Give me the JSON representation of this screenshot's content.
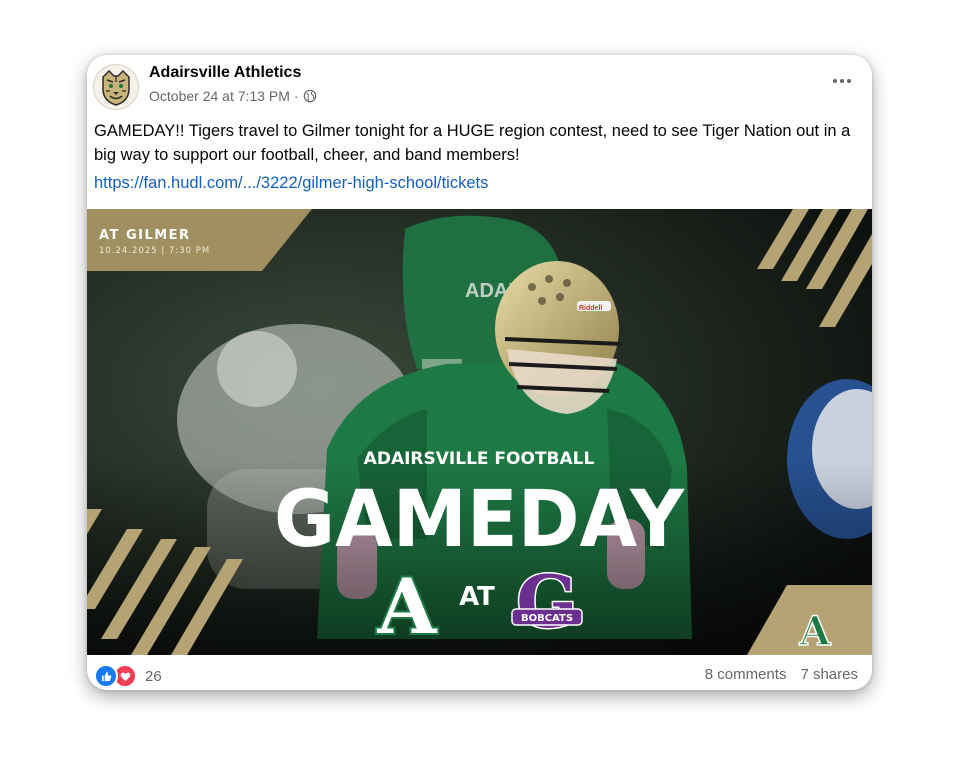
{
  "post": {
    "author": "Adairsville Athletics",
    "timestamp": "October 24 at 7:13 PM",
    "separator": "·",
    "privacy_icon": "globe-icon",
    "more_icon": "more-horizontal-icon",
    "text": "GAMEDAY!! Tigers travel to Gilmer tonight for a HUGE region contest, need to see Tiger Nation out in a big way to support our football, cheer, and band members!",
    "link": "https://fan.hudl.com/.../3222/gilmer-high-school/tickets"
  },
  "graphic": {
    "location": "AT GILMER",
    "date_time": "10.24.2025 | 7:30 PM",
    "program": "ADAIRSVILLE FOOTBALL",
    "headline": "GAMEDAY",
    "home_logo_letter": "A",
    "versus": "AT",
    "away_logo_letter": "G",
    "away_logo_text": "BOBCATS",
    "corner_logo_letter": "A",
    "jersey_text": "ADAI",
    "helmet_brand": "Riddell",
    "colors": {
      "gold": "#b5a373",
      "green": "#1e7a44",
      "purple": "#6b2f8f",
      "dark": "#141814"
    }
  },
  "footer": {
    "reaction_icons": [
      "like-icon",
      "love-icon"
    ],
    "reaction_count": "26",
    "comments": "8 comments",
    "shares": "7 shares"
  }
}
